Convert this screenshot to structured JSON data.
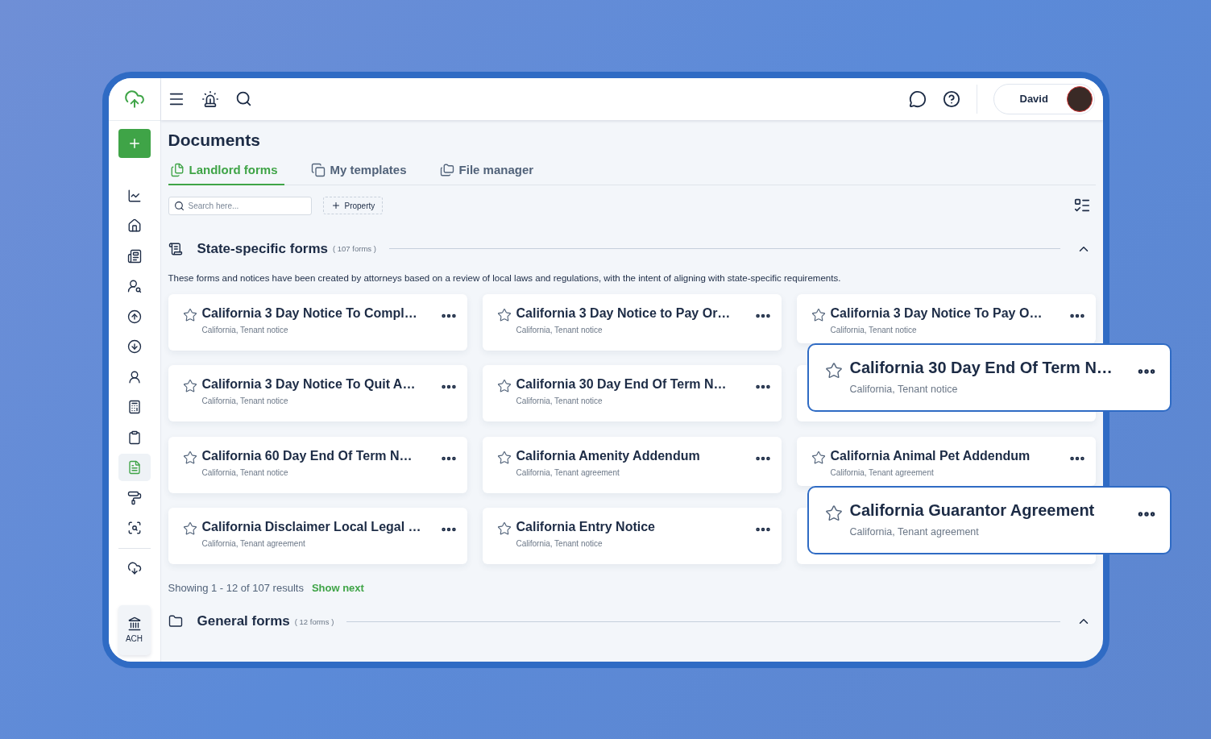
{
  "sidebar": {
    "nav_items": [
      {
        "selected": false
      },
      {
        "selected": false
      },
      {
        "selected": false
      },
      {
        "selected": false
      },
      {
        "selected": false
      },
      {
        "selected": false
      },
      {
        "selected": false
      },
      {
        "selected": false
      },
      {
        "selected": false
      },
      {
        "selected": true
      },
      {
        "selected": false
      },
      {
        "selected": false
      },
      {
        "selected": false
      }
    ],
    "ach_button": {
      "label": "ACH"
    }
  },
  "topbar": {
    "user": {
      "name": "David"
    }
  },
  "page_title": "Documents",
  "tabs": [
    {
      "label": "Landlord forms",
      "selected": true
    },
    {
      "label": "My templates",
      "selected": false
    },
    {
      "label": "File manager",
      "selected": false
    }
  ],
  "search": {
    "placeholder": "Search here..."
  },
  "filter_button": {
    "label": "Property"
  },
  "sections": [
    {
      "title": "State-specific forms",
      "count": "( 107 forms )",
      "expanded": true,
      "description": "These forms and notices have been created by attorneys based on a review of local laws and regulations, with the intent of aligning with state-specific requirements.",
      "cards": [
        {
          "kind": "card",
          "title": "California 3 Day Notice To Compl…",
          "subtitle": "California, Tenant notice"
        },
        {
          "kind": "card",
          "title": "California 3 Day Notice to Pay Or…",
          "subtitle": "California, Tenant notice"
        },
        {
          "kind": "card",
          "title": "California 3 Day Notice To Pay O…",
          "subtitle": "California, Tenant notice"
        },
        {
          "kind": "card",
          "title": "California 3 Day Notice To Quit A…",
          "subtitle": "California, Tenant notice"
        },
        {
          "kind": "card",
          "title": "California 30 Day End Of Term N…",
          "subtitle": "California, Tenant notice"
        },
        {
          "kind": "highlighted",
          "title": "California 30 Day End Of Term N…",
          "subtitle": "California, Tenant notice"
        },
        {
          "kind": "card",
          "title": "California 60 Day End Of Term N…",
          "subtitle": "California, Tenant notice"
        },
        {
          "kind": "card",
          "title": "California Amenity Addendum",
          "subtitle": "California, Tenant agreement"
        },
        {
          "kind": "card",
          "title": "California Animal Pet Addendum",
          "subtitle": "California, Tenant agreement"
        },
        {
          "kind": "card",
          "title": "California Disclaimer Local Legal …",
          "subtitle": "California, Tenant agreement"
        },
        {
          "kind": "card",
          "title": "California Entry Notice",
          "subtitle": "California, Tenant notice"
        },
        {
          "kind": "highlighted",
          "title": "California Guarantor Agreement",
          "subtitle": "California, Tenant agreement"
        }
      ],
      "pagination": {
        "summary": "Showing 1 - 12 of 107 results",
        "link": "Show next"
      }
    },
    {
      "title": "General forms",
      "count": "( 12 forms )",
      "expanded": true
    }
  ]
}
